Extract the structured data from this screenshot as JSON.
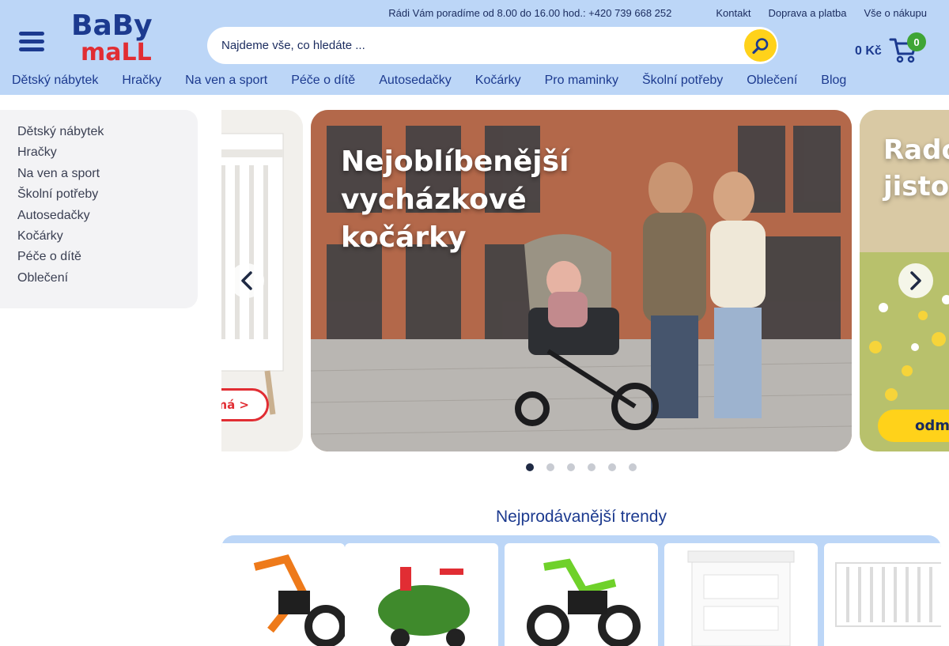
{
  "header": {
    "hotline": "Rádi Vám poradíme od 8.00 do 16.00 hod.: +420 739 668 252",
    "links": [
      "Kontakt",
      "Doprava a platba",
      "Vše o nákupu"
    ],
    "logo_text_top": "BaBy",
    "logo_text_bottom": "maLL",
    "search_placeholder": "Najdeme vše, co hledáte ...",
    "cart_price": "0 Kč",
    "cart_count": "0"
  },
  "nav": [
    "Dětský nábytek",
    "Hračky",
    "Na ven a sport",
    "Péče o dítě",
    "Autosedačky",
    "Kočárky",
    "Pro maminky",
    "Školní potřeby",
    "Oblečení",
    "Blog"
  ],
  "sidebar": [
    "Dětský nábytek",
    "Hračky",
    "Na ven a sport",
    "Školní potřeby",
    "Autosedačky",
    "Kočárky",
    "Péče o dítě",
    "Oblečení"
  ],
  "slider": {
    "prev_cta": "jímá >",
    "main_title": "Nejoblíbenější\nvycházkové\nkočárky",
    "next_title": "Rado\njisto",
    "next_cta": "odm",
    "dots": 6,
    "active_dot": 0
  },
  "trends": {
    "title": "Nejprodávanější trendy"
  },
  "colors": {
    "header_bg": "#bcd6f7",
    "brand_blue": "#1c3a8f",
    "accent_yellow": "#ffd21a",
    "badge_green": "#3fa535",
    "red": "#e12d33"
  }
}
